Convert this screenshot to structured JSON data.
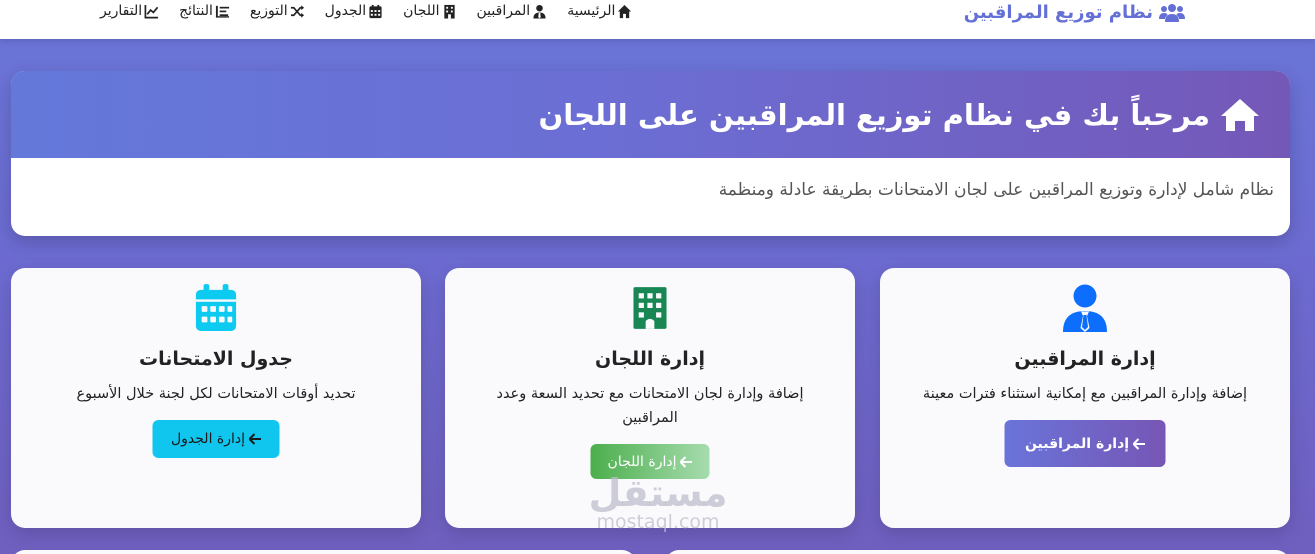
{
  "navbar": {
    "brand": "نظام توزيع المراقبين",
    "brand_icon": "users-group-icon",
    "links": [
      {
        "label": "الرئيسية",
        "icon": "home-icon"
      },
      {
        "label": "المراقبين",
        "icon": "user-tie-icon"
      },
      {
        "label": "اللجان",
        "icon": "building-icon"
      },
      {
        "label": "الجدول",
        "icon": "calendar-icon"
      },
      {
        "label": "التوزيع",
        "icon": "shuffle-icon"
      },
      {
        "label": "النتائج",
        "icon": "list-icon"
      },
      {
        "label": "التقارير",
        "icon": "chart-line-icon"
      }
    ]
  },
  "welcome": {
    "title": "مرحباً بك في نظام توزيع المراقبين على اللجان",
    "subtitle": "نظام شامل لإدارة وتوزيع المراقبين على لجان الامتحانات بطريقة عادلة ومنظمة",
    "icon": "home-icon"
  },
  "cards": [
    {
      "title": "إدارة المراقبين",
      "description": "إضافة وإدارة المراقبين مع إمكانية استثناء فترات معينة",
      "button": "إدارة المراقبين",
      "icon": "user-tie-icon",
      "icon_color": "#0d6efd"
    },
    {
      "title": "إدارة اللجان",
      "description": "إضافة وإدارة لجان الامتحانات مع تحديد السعة وعدد المراقبين",
      "button": "إدارة اللجان",
      "icon": "building-icon",
      "icon_color": "#198754"
    },
    {
      "title": "جدول الامتحانات",
      "description": "تحديد أوقات الامتحانات لكل لجنة خلال الأسبوع",
      "button": "إدارة الجدول",
      "icon": "calendar-icon",
      "icon_color": "#0dcaf0"
    }
  ],
  "watermark": {
    "arabic": "مستقل",
    "latin": "mostaql.com"
  },
  "colors": {
    "brand": "#6470d6",
    "gradient_start": "#6a76d8",
    "gradient_end": "#7458b8",
    "success": "#198754",
    "info": "#0dcaf0",
    "primary": "#0d6efd"
  }
}
